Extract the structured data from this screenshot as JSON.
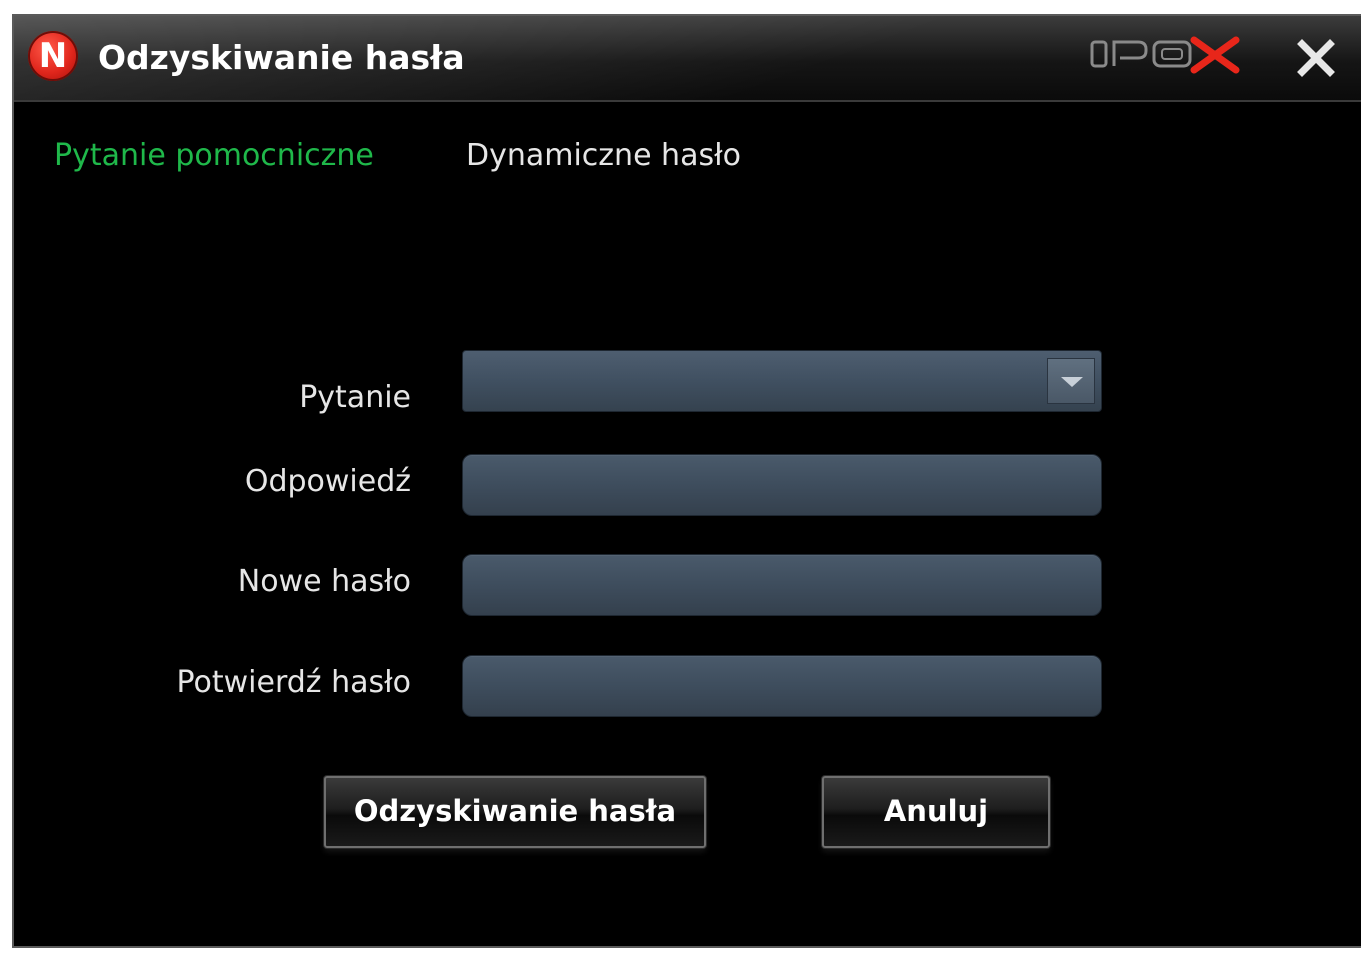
{
  "window": {
    "title": "Odzyskiwanie hasła",
    "app_logo_letter": "N",
    "brand_logo": "IPOX",
    "close_icon": "close-icon"
  },
  "tabs": [
    {
      "label": "Pytanie pomocniczne",
      "active": true,
      "color": "#1fb84a"
    },
    {
      "label": "Dynamiczne hasło",
      "active": false
    }
  ],
  "form": {
    "question_label": "Pytanie",
    "question_value": "",
    "answer_label": "Odpowiedź",
    "answer_value": "",
    "new_password_label": "Nowe hasło",
    "new_password_value": "",
    "confirm_password_label": "Potwierdź hasło",
    "confirm_password_value": ""
  },
  "buttons": {
    "recover_label": "Odzyskiwanie hasła",
    "cancel_label": "Anuluj"
  }
}
